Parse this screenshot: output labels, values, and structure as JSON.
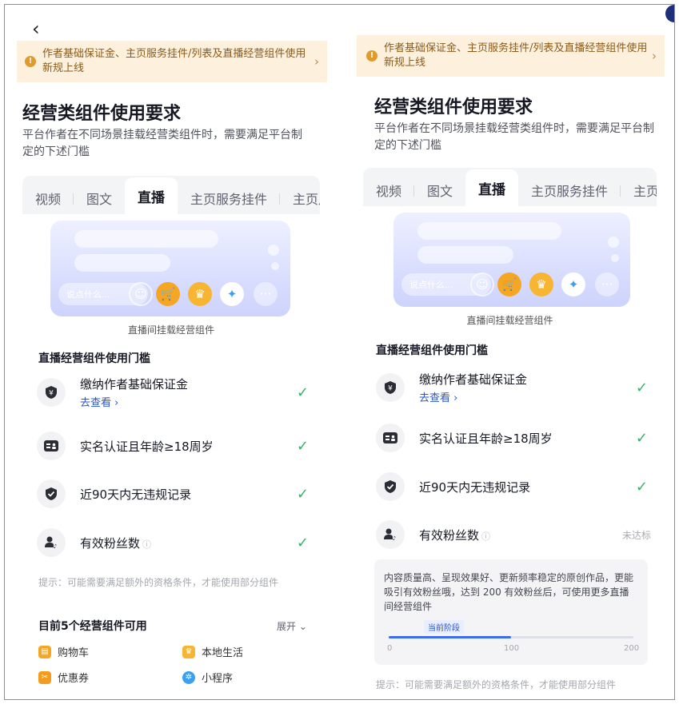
{
  "nav": {
    "back_glyph": "‹"
  },
  "notice": {
    "text": "作者基础保证金、主页服务挂件/列表及直播经营组件使用新规上线",
    "warn_glyph": "!",
    "chevron": "›"
  },
  "header": {
    "title": "经营类组件使用要求",
    "subtitle": "平台作者在不同场景挂载经营类组件时，需要满足平台制定的下述门槛"
  },
  "tabs": [
    {
      "label": "视频",
      "active": false
    },
    {
      "label": "图文",
      "active": false
    },
    {
      "label": "直播",
      "active": true
    },
    {
      "label": "主页服务挂件",
      "active": false
    },
    {
      "label": "主页月",
      "active": false
    }
  ],
  "preview": {
    "input_placeholder": "说点什么...",
    "caption": "直播间挂载经营组件"
  },
  "requirements_title": "直播经营组件使用门槛",
  "left": {
    "requirements": [
      {
        "icon": "shield-yen-icon",
        "label": "缴纳作者基础保证金",
        "link": "去查看 ›",
        "status": "✓"
      },
      {
        "icon": "id-card-icon",
        "label": "实名认证且年龄≥18周岁",
        "link": "",
        "status": "✓"
      },
      {
        "icon": "shield-check-icon",
        "label": "近90天内无违规记录",
        "link": "",
        "status": "✓"
      },
      {
        "icon": "fans-icon",
        "label": "有效粉丝数",
        "link": "",
        "status": "✓",
        "info": "ⓘ"
      }
    ],
    "hint": "提示：可能需要满足额外的资格条件，才能使用部分组件",
    "available": {
      "title": "目前5个经营组件可用",
      "expand": "展开 ⌄",
      "items": [
        {
          "icon": "cart-icon",
          "label": "购物车",
          "color": "#f5a623"
        },
        {
          "icon": "local-life-icon",
          "label": "本地生活",
          "color": "#f7b532"
        },
        {
          "icon": "coupon-icon",
          "label": "优惠券",
          "color": "#f39c1e"
        },
        {
          "icon": "mini-program-icon",
          "label": "小程序",
          "color": "#3aa0f2"
        }
      ]
    }
  },
  "right": {
    "requirements": [
      {
        "icon": "shield-yen-icon",
        "label": "缴纳作者基础保证金",
        "link": "去查看 ›",
        "status": "✓"
      },
      {
        "icon": "id-card-icon",
        "label": "实名认证且年龄≥18周岁",
        "link": "",
        "status": "✓"
      },
      {
        "icon": "shield-check-icon",
        "label": "近90天内无违规记录",
        "link": "",
        "status": "✓"
      },
      {
        "icon": "fans-icon",
        "label": "有效粉丝数",
        "link": "",
        "status": "未达标",
        "info": "ⓘ"
      }
    ],
    "fan_progress": {
      "description": "内容质量高、呈现效果好、更新频率稳定的原创作品，更能吸引有效粉丝哦，达到 200 有效粉丝后，可使用更多直播间经营组件",
      "stage_label": "当前阶段",
      "ticks": [
        "0",
        "100",
        "200"
      ],
      "progress": 0.5
    },
    "hint": "提示：可能需要满足额外的资格条件，才能使用部分组件"
  },
  "colors": {
    "accent": "#2e55c6",
    "check": "#38b26a",
    "notice_bg": "#fdf1dd",
    "notice_text": "#8a5a1a"
  }
}
